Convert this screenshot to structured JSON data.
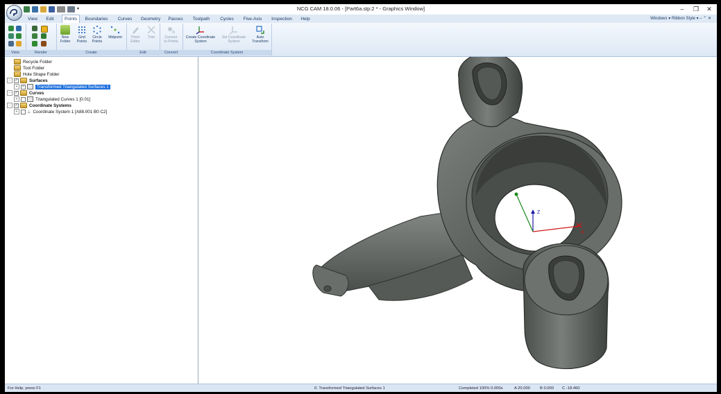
{
  "window": {
    "title": "NCG CAM 18.0.06 - [Part6a.stp:2 * - Graphics Window]"
  },
  "tabs": [
    {
      "label": "View",
      "active": false
    },
    {
      "label": "Edit",
      "active": false
    },
    {
      "label": "Points",
      "active": true
    },
    {
      "label": "Boundaries",
      "active": false
    },
    {
      "label": "Curves",
      "active": false
    },
    {
      "label": "Geometry",
      "active": false
    },
    {
      "label": "Passes",
      "active": false
    },
    {
      "label": "Toolpath",
      "active": false
    },
    {
      "label": "Cycles",
      "active": false
    },
    {
      "label": "Five-Axis",
      "active": false
    },
    {
      "label": "Inspection",
      "active": false
    },
    {
      "label": "Help",
      "active": false
    }
  ],
  "right_menu": {
    "windows": "Windows",
    "ribbon_style": "Ribbon Style"
  },
  "ribbon": {
    "groups": {
      "view": "View",
      "render": "Render",
      "create": "Create",
      "edit": "Edit",
      "convert": "Convert",
      "coordinate_system": "Coordinate System"
    },
    "buttons": {
      "new_folder": [
        "New",
        "Folder"
      ],
      "grid_points": [
        "Grid",
        "Points"
      ],
      "circle_points": [
        "Circle",
        "Points"
      ],
      "midpoint": [
        "Midpoint",
        ""
      ],
      "point_editor": [
        "Point",
        "Editor"
      ],
      "trim": [
        "Trim",
        ""
      ],
      "convert_to_points": [
        "Convert",
        "to Points"
      ],
      "create_coordinate_system": [
        "Create Coordinate",
        "System"
      ],
      "set_coordinate_system": [
        "Set Coordinate",
        "System"
      ],
      "auto_transform": [
        "Auto",
        "Transform"
      ]
    }
  },
  "tree": {
    "recycle": "Recycle Folder",
    "tool": "Tool Folder",
    "hole_shape": "Hole Shape Folder",
    "surfaces": "Surfaces",
    "surfaces_child": "Transformed Triangulated Surfaces 1",
    "curves": "Curves",
    "curves_child": "Triangulated Curves 1 [0.01]",
    "coord_systems": "Coordinate Systems",
    "coord_child": "Coordinate System 1 [A88.001 B0 C2]"
  },
  "axes": {
    "z": "Z",
    "x": "X"
  },
  "status": {
    "help": "For Help, press F1",
    "center": "0.  Transformed Triangulated Surfaces 1",
    "completed": "Completed  100%  0.000s",
    "a": "A 20.000",
    "b": "B 0.000",
    "c": "C -18.460"
  },
  "colors": {
    "ribbon_bg": "#dde8f5",
    "tab_text": "#1d3b66",
    "selection": "#1f6fdc",
    "part_gray": "#5f625f",
    "axis_z": "#1a1aa8",
    "axis_y": "#1a8a1a",
    "axis_x": "#d01818"
  }
}
